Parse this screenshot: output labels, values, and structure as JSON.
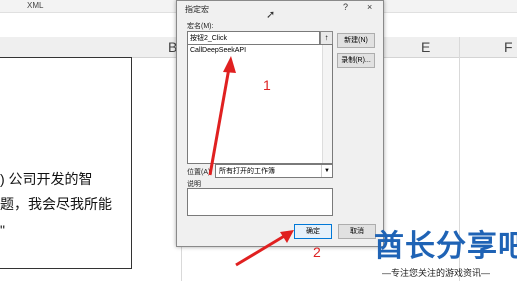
{
  "excel": {
    "ribbon_text": "XML",
    "columns": [
      "B",
      "E",
      "F"
    ],
    "doc_lines": [
      ") 公司开发的智",
      "题，我会尽我所能",
      "\""
    ]
  },
  "dialog": {
    "title": "指定宏",
    "help_btn": "?",
    "close_btn": "×",
    "macro_name_label": "宏名(M):",
    "macro_name_value": "按钮2_Click",
    "up_button": "↑",
    "macros": [
      "CallDeepSeekAPI"
    ],
    "new_button": "新建(N)",
    "record_button": "录制(R)...",
    "location_label": "位置(A):",
    "location_value": "所有打开的工作簿",
    "description_label": "说明",
    "ok_button": "确定",
    "cancel_button": "取消"
  },
  "annotations": {
    "num1": "1",
    "num2": "2"
  },
  "watermark": {
    "brand": "酋长分享吧",
    "tagline": "—专注您关注的游戏资讯—"
  },
  "colors": {
    "arrow": "#e02020",
    "brand": "#1f63b5",
    "focus": "#0078d7"
  }
}
